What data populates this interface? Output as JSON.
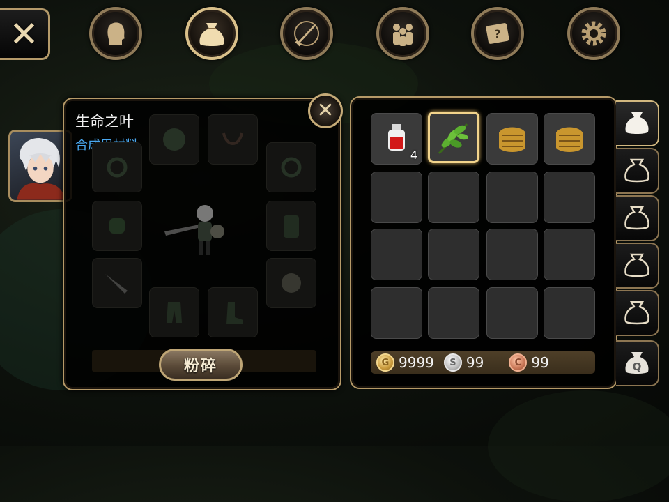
{
  "top_bar": {
    "close_icon": "close-icon",
    "tabs": [
      {
        "icon": "character-head-icon",
        "active": false
      },
      {
        "icon": "bag-icon",
        "active": true
      },
      {
        "icon": "sword-compass-icon",
        "active": false
      },
      {
        "icon": "party-icon",
        "active": false
      },
      {
        "icon": "quest-scroll-icon",
        "active": false
      },
      {
        "icon": "settings-gear-icon",
        "active": false
      }
    ]
  },
  "item_detail": {
    "name": "生命之叶",
    "type": "合成用材料",
    "action_label": "粉碎",
    "close_icon": "close-icon"
  },
  "inventory": {
    "slots": [
      {
        "item": "red-potion-icon",
        "count": "4"
      },
      {
        "item": "green-leaf-icon",
        "count": "",
        "selected": true
      },
      {
        "item": "leather-armor-icon",
        "count": ""
      },
      {
        "item": "leather-armor-icon",
        "count": ""
      }
    ],
    "empty_slots": 12,
    "currency": {
      "gold": "9999",
      "silver": "99",
      "copper": "99"
    }
  },
  "bag_tabs": [
    {
      "icon": "bag-icon",
      "active": true
    },
    {
      "icon": "bag-outline-icon",
      "active": false
    },
    {
      "icon": "bag-outline-icon",
      "active": false
    },
    {
      "icon": "bag-outline-icon",
      "active": false
    },
    {
      "icon": "bag-outline-icon",
      "active": false
    },
    {
      "icon": "quest-bag-icon",
      "label": "Q",
      "active": false
    }
  ],
  "colors": {
    "accent_gold": "#d9c08a",
    "item_type_blue": "#4aa8f0",
    "selected_border": "#f2d48c"
  }
}
